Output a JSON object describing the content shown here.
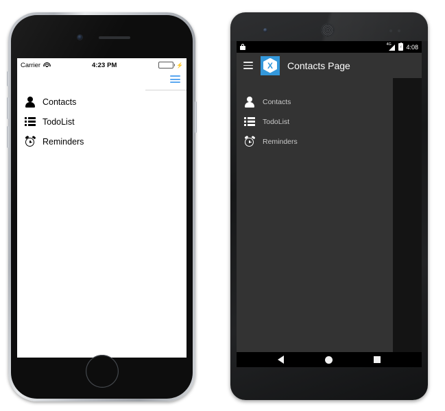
{
  "ios": {
    "device_name": "iPhone",
    "status_bar": {
      "carrier": "Carrier",
      "wifi_icon": "wifi-icon",
      "time": "4:23 PM",
      "battery_icon": "battery-icon",
      "charging_icon": "lightning-bolt-icon"
    },
    "nav": {
      "menu_icon": "hamburger-menu-icon"
    },
    "menu_items": [
      {
        "label": "Contacts",
        "icon": "person-icon"
      },
      {
        "label": "TodoList",
        "icon": "bulleted-list-icon"
      },
      {
        "label": "Reminders",
        "icon": "alarm-clock-icon"
      }
    ]
  },
  "android": {
    "device_name": "Android phone",
    "status_bar": {
      "lock_icon": "lock-icon",
      "signal_label": "4G",
      "signal_icon": "signal-bars-icon",
      "battery_icon": "battery-icon",
      "time": "4:08"
    },
    "toolbar": {
      "menu_icon": "hamburger-menu-icon",
      "logo_icon": "xamarin-logo-icon",
      "logo_letter": "X",
      "title": "Contacts Page"
    },
    "menu_items": [
      {
        "label": "Contacts",
        "icon": "person-icon"
      },
      {
        "label": "TodoList",
        "icon": "bulleted-list-icon"
      },
      {
        "label": "Reminders",
        "icon": "alarm-clock-icon"
      }
    ],
    "nav_bar": {
      "back_icon": "back-triangle-icon",
      "home_icon": "home-circle-icon",
      "recents_icon": "recents-square-icon"
    }
  },
  "colors": {
    "ios_accent": "#5aa7f0",
    "ios_battery": "#4cd964",
    "android_toolbar": "#333333",
    "android_logo": "#3498db",
    "android_content": "#141414"
  }
}
